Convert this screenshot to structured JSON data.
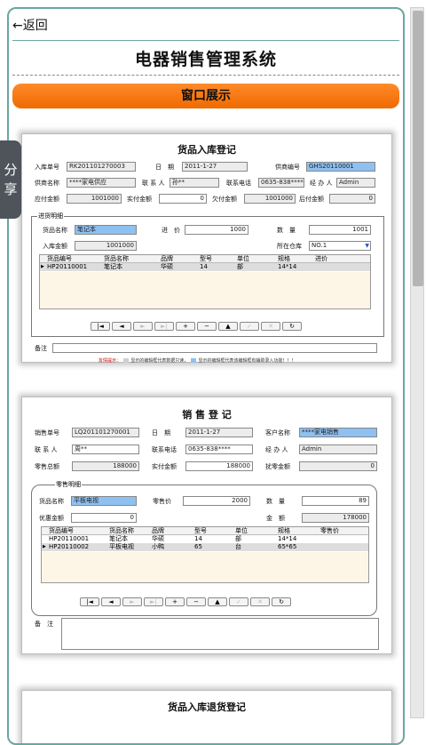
{
  "nav": {
    "back_label": "←返回"
  },
  "page": {
    "title": "电器销售管理系统",
    "section_button": "窗口展示"
  },
  "share": {
    "label": "分享"
  },
  "card1": {
    "title": "货品入库登记",
    "labels": {
      "order_no": "入库单号",
      "date": "日　期",
      "supplier_no": "供商编号",
      "supplier_name": "供商名称",
      "contact": "联 系 人",
      "phone": "联系电话",
      "handler": "经 办 人",
      "payable": "应付金额",
      "paid": "实付金额",
      "owed": "欠付金额",
      "after": "后付金额",
      "detail_group": "进货明细",
      "product_name": "货品名称",
      "price": "进　价",
      "qty": "数　量",
      "amount": "入库金额",
      "warehouse": "所在仓库",
      "remark": "备注"
    },
    "values": {
      "order_no": "RK201101270003",
      "date": "2011-1-27",
      "supplier_no": "GHS20110001",
      "supplier_name": "****家电供应",
      "contact": "孙**",
      "phone": "0635-838****",
      "handler": "Admin",
      "payable": "1001000",
      "paid": "0",
      "owed": "1001000",
      "after": "0",
      "product_name": "笔记本",
      "price": "1000",
      "qty": "1001",
      "amount": "1001000",
      "warehouse": "NO.1"
    },
    "table_headers": [
      "货品编号",
      "货品名称",
      "品牌",
      "型号",
      "单位",
      "规格",
      "进价"
    ],
    "rows": [
      [
        "HP20110001",
        "笔记本",
        "华硕",
        "14",
        "部",
        "14*14",
        ""
      ]
    ],
    "nav_buttons": [
      "|◄",
      "◄",
      "►",
      "►|",
      "+",
      "−",
      "▲",
      "✓",
      "✕",
      "↻"
    ],
    "warning": "友情提示：",
    "legend_gray": "显示的编辑框代表数据只读，",
    "legend_blue": "显示的编辑框代表该编辑框有辅助录入功能！！！"
  },
  "card2": {
    "title": "销 售 登 记",
    "labels": {
      "order_no": "销售单号",
      "date": "日　期",
      "customer": "客户名称",
      "contact": "联 系 人",
      "phone": "联系电话",
      "handler": "经 办 人",
      "total": "零售总额",
      "paid": "实付金额",
      "discount": "扰零金额",
      "detail_group": "零售明细",
      "product_name": "货品名称",
      "retail_price": "零售价",
      "qty": "数　量",
      "promo": "优惠金额",
      "amount": "金　额",
      "remark": "备　注"
    },
    "values": {
      "order_no": "LQ201101270001",
      "date": "2011-1-27",
      "customer": "****家电销售",
      "contact": "周**",
      "phone": "0635-838****",
      "handler": "Admin",
      "total": "188000",
      "paid": "188000",
      "discount": "0",
      "product_name": "平板电视",
      "retail_price": "2000",
      "qty": "89",
      "promo": "0",
      "amount": "178000"
    },
    "table_headers": [
      "货品编号",
      "货品名称",
      "品牌",
      "型号",
      "单位",
      "规格",
      "零售价"
    ],
    "rows": [
      [
        "HP20110001",
        "笔记本",
        "华硕",
        "14",
        "部",
        "14*14",
        ""
      ],
      [
        "HP20110002",
        "平板电视",
        "小鸭",
        "65",
        "台",
        "65*65",
        ""
      ]
    ],
    "nav_buttons": [
      "|◄",
      "◄",
      "►",
      "►|",
      "+",
      "−",
      "▲",
      "✓",
      "✕",
      "↻"
    ]
  },
  "card3": {
    "title": "货品入库退货登记"
  },
  "colors": {
    "accent": "#ef6a00",
    "frame": "#6aa79f",
    "lookup_field": "#8ec0f2",
    "readonly_field": "#ececec"
  }
}
